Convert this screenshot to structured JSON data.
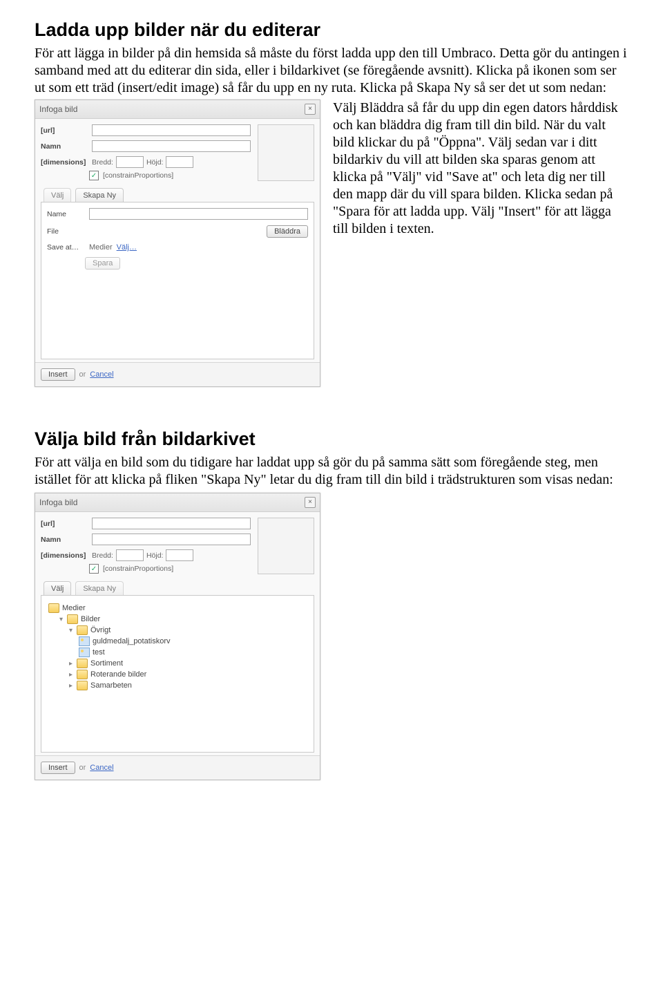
{
  "section1": {
    "heading": "Ladda upp bilder när du editerar",
    "para": "För att lägga in bilder på din hemsida så måste du först ladda upp den till Umbraco. Detta gör du antingen i samband med att du editerar din sida, eller i bildarkivet (se föregående avsnitt). Klicka på ikonen som ser ut som ett träd (insert/edit image) så får du upp en ny ruta. Klicka på Skapa Ny så ser det ut som nedan:"
  },
  "dialog": {
    "title": "Infoga bild",
    "labels": {
      "url": "[url]",
      "namn": "Namn",
      "dimensions": "[dimensions]",
      "bredd": "Bredd:",
      "hojd": "Höjd:",
      "constrain": "[constrainProportions]"
    },
    "tabs": {
      "valj": "Välj",
      "skapa": "Skapa Ny"
    },
    "upload": {
      "name": "Name",
      "file": "File",
      "saveat": "Save at…",
      "medier": "Medier",
      "valjlink": "Välj…",
      "bladdra": "Bläddra",
      "spara": "Spara"
    },
    "footer": {
      "insert": "Insert",
      "or": "or",
      "cancel": "Cancel"
    }
  },
  "sidepara": "Välj Bläddra så får du upp din egen dators hårddisk och kan bläddra dig fram till din bild. När du valt bild klickar du på \"Öppna\". Välj sedan var i ditt bildarkiv du vill att bilden ska sparas genom att klicka på \"Välj\" vid \"Save at\" och leta dig ner till den mapp där du vill spara bilden. Klicka sedan på \"Spara för att ladda upp. Välj \"Insert\" för att lägga till bilden i texten.",
  "section2": {
    "heading": "Välja bild från bildarkivet",
    "para": "För att välja en bild som du tidigare har laddat upp så gör du på samma sätt som föregående steg, men istället för att klicka på fliken \"Skapa Ny\" letar du dig fram till din bild i trädstrukturen som visas nedan:"
  },
  "tree": {
    "root": "Medier",
    "bilder": "Bilder",
    "ovrigt": "Övrigt",
    "item1": "guldmedalj_potatiskorv",
    "item2": "test",
    "sortiment": "Sortiment",
    "roterande": "Roterande bilder",
    "samarbeten": "Samarbeten"
  }
}
